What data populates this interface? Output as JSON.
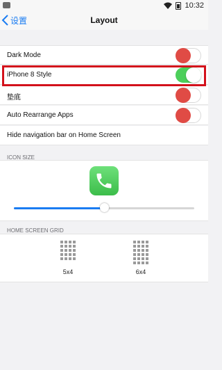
{
  "status_bar": {
    "time": "10:32"
  },
  "nav": {
    "back_label": "设置",
    "title": "Layout"
  },
  "settings": [
    {
      "label": "Dark Mode",
      "toggle": "off"
    },
    {
      "label": "iPhone 8 Style",
      "toggle": "on"
    },
    {
      "label": "垫底",
      "toggle": "off"
    },
    {
      "label": "Auto Rearrange Apps",
      "toggle": "off"
    },
    {
      "label": "Hide navigation bar on Home Screen"
    }
  ],
  "icon_size": {
    "header": "ICON SIZE",
    "app_icon": "phone-icon",
    "slider_value": 0.5
  },
  "home_grid": {
    "header": "HOME SCREEN GRID",
    "options": [
      {
        "label": "5x4",
        "rows": 5,
        "cols": 4
      },
      {
        "label": "6x4",
        "rows": 6,
        "cols": 4
      }
    ]
  },
  "colors": {
    "accent": "#1a7cf2",
    "toggle_on": "#4ccf5a",
    "toggle_off_knob": "#e04b45",
    "highlight": "#d3111b"
  }
}
